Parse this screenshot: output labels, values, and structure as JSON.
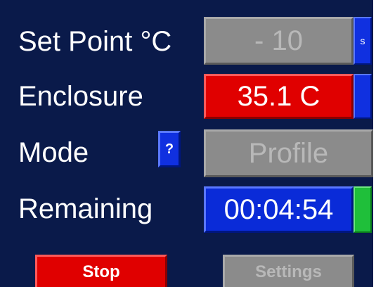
{
  "rows": {
    "set_point": {
      "label": "Set Point °C",
      "value": "-  10",
      "tab_label": "s"
    },
    "enclosure": {
      "label": "Enclosure",
      "value": "35.1 C"
    },
    "mode": {
      "label": "Mode",
      "help_label": "?",
      "value": "Profile"
    },
    "remaining": {
      "label": "Remaining",
      "value": "00:04:54"
    }
  },
  "buttons": {
    "stop": "Stop",
    "settings": "Settings"
  },
  "colors": {
    "background": "#0a1a4a",
    "disabled": "#8b8b8b",
    "alert_red": "#e00000",
    "active_blue": "#0a2bd8",
    "ok_green": "#1fbf3a"
  }
}
